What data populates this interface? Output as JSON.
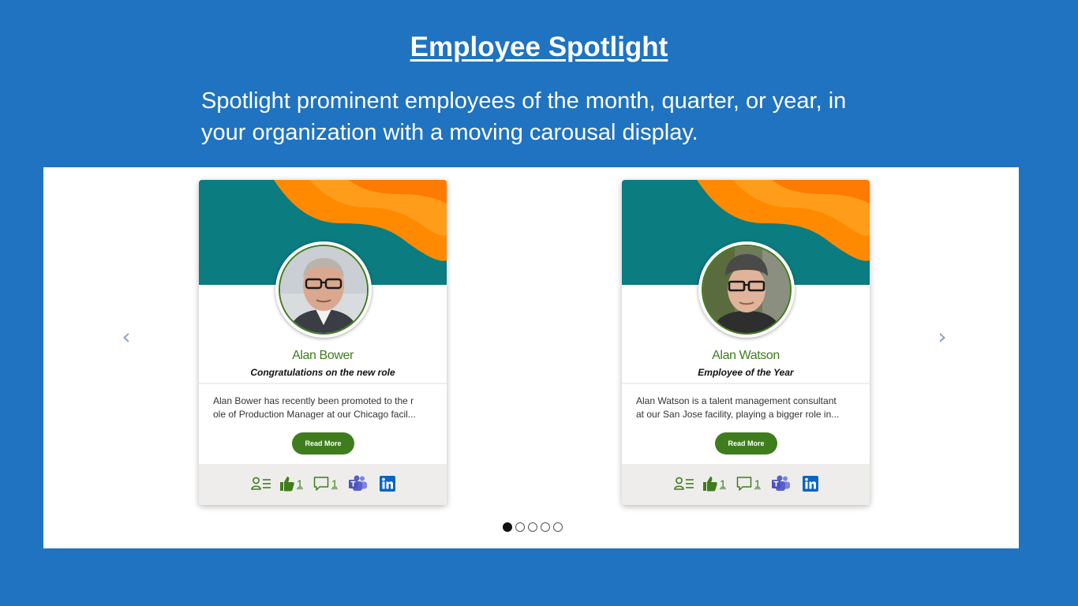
{
  "header": {
    "title": "Employee Spotlight",
    "subtitle_line1": "Spotlight prominent employees of the month, quarter, or year, in",
    "subtitle_line2": "your organization with a moving carousal display."
  },
  "carousel": {
    "prev_icon": "chevron-left-icon",
    "next_icon": "chevron-right-icon",
    "prev_glyph": "‹",
    "next_glyph": "›",
    "dot_count": 5,
    "active_dot": 0
  },
  "cards": [
    {
      "name": "Alan Bower",
      "role": "Congratulations on the new role",
      "desc_line1": "Alan Bower has recently been promoted to the r",
      "desc_line2": "ole of Production Manager at our Chicago facil...",
      "button": "Read More",
      "likes": "1",
      "comments": "1"
    },
    {
      "name": "Alan Watson",
      "role": "Employee of the Year",
      "desc_line1": "Alan Watson is a talent management consultant",
      "desc_line2": "at our San Jose facility, playing a bigger role in...",
      "button": "Read More",
      "likes": "1",
      "comments": "1"
    }
  ],
  "colors": {
    "background": "#1f73c0",
    "teal": "#0b7c80",
    "orange": "#ff8a00",
    "green": "#3f7d1c",
    "footer": "#eeedeb",
    "teams": "#5b5fc7",
    "linkedin": "#0a66c2"
  }
}
